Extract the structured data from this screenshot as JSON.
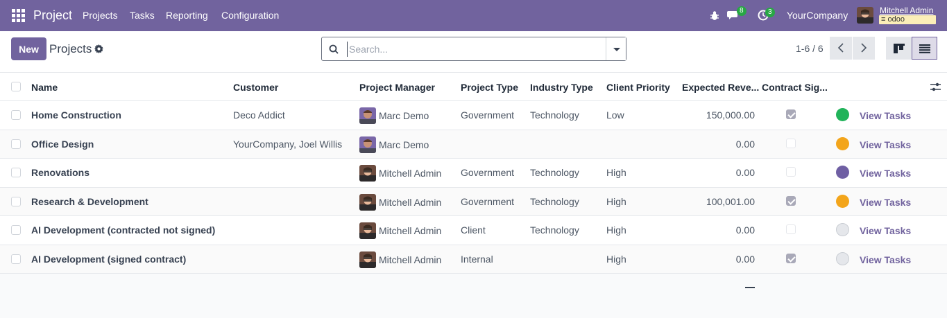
{
  "navbar": {
    "app_name": "Project",
    "menu": [
      "Projects",
      "Tasks",
      "Reporting",
      "Configuration"
    ],
    "messages_count": "8",
    "activities_count": "3",
    "company": "YourCompany",
    "user_name": "Mitchell Admin",
    "database": "odoo",
    "color": "#71639e"
  },
  "control_panel": {
    "new_label": "New",
    "title": "Projects",
    "search_placeholder": "Search...",
    "pager": "1-6 / 6"
  },
  "table": {
    "headers": [
      "Name",
      "Customer",
      "Project Manager",
      "Project Type",
      "Industry Type",
      "Client Priority",
      "Expected Reve...",
      "Contract Sig..."
    ],
    "view_tasks_label": "View Tasks",
    "rows": [
      {
        "name": "Home Construction",
        "customer": "Deco Addict",
        "manager": "Marc Demo",
        "project_type": "Government",
        "industry_type": "Technology",
        "priority": "Low",
        "revenue": "150,000.00",
        "signed": true,
        "status_color": "#21b35a"
      },
      {
        "name": "Office Design",
        "customer": "YourCompany, Joel Willis",
        "manager": "Marc Demo",
        "project_type": "",
        "industry_type": "",
        "priority": "",
        "revenue": "0.00",
        "signed": false,
        "status_color": "#f3a51b"
      },
      {
        "name": "Renovations",
        "customer": "",
        "manager": "Mitchell Admin",
        "project_type": "Government",
        "industry_type": "Technology",
        "priority": "High",
        "revenue": "0.00",
        "signed": false,
        "status_color": "#6f5fa3"
      },
      {
        "name": "Research & Development",
        "customer": "",
        "manager": "Mitchell Admin",
        "project_type": "Government",
        "industry_type": "Technology",
        "priority": "High",
        "revenue": "100,001.00",
        "signed": true,
        "status_color": "#f3a51b"
      },
      {
        "name": "AI Development (contracted not signed)",
        "customer": "",
        "manager": "Mitchell Admin",
        "project_type": "Client",
        "industry_type": "Technology",
        "priority": "High",
        "revenue": "0.00",
        "signed": false,
        "status_color": "#e5e7eb"
      },
      {
        "name": "AI Development (signed contract)",
        "customer": "",
        "manager": "Mitchell Admin",
        "project_type": "Internal",
        "industry_type": "",
        "priority": "High",
        "revenue": "0.00",
        "signed": true,
        "status_color": "#e5e7eb"
      }
    ]
  }
}
